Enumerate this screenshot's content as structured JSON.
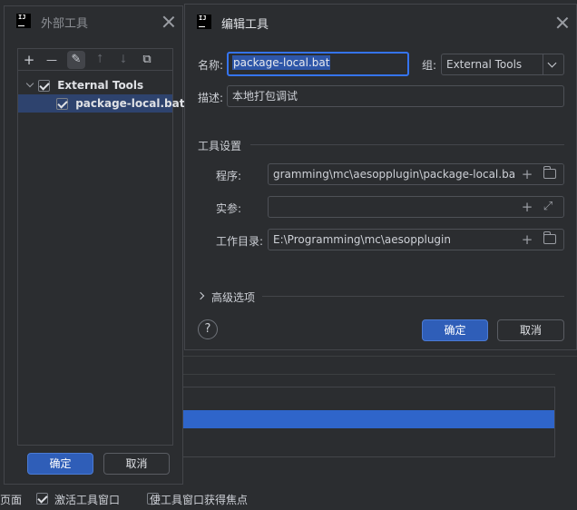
{
  "background": {
    "bottom_bar": {
      "partial_label": "页面",
      "activate_label": "激活工具窗口",
      "activate_checked": true,
      "focus_label": "使工具窗口获得焦点",
      "focus_checked": false
    }
  },
  "dialog_external_tools": {
    "title": "外部工具",
    "toolbar": {
      "add_icon": "+",
      "remove_icon": "—",
      "edit_icon": "✎",
      "up_icon": "⭡",
      "down_icon": "⭣",
      "copy_icon": "⧉"
    },
    "tree": {
      "group_label": "External Tools",
      "group_checked": true,
      "item_label": "package-local.bat",
      "item_checked": true
    },
    "ok_label": "确定",
    "cancel_label": "取消"
  },
  "dialog_edit_tool": {
    "title": "编辑工具",
    "name_label": "名称:",
    "name_value": "package-local.bat",
    "group_label": "组:",
    "group_value": "External Tools",
    "description_label": "描述:",
    "description_value": "本地打包调试",
    "tool_settings_label": "工具设置",
    "program_label": "程序:",
    "program_value": "gramming\\mc\\aesopplugin\\package-local.bat",
    "arguments_label": "实参:",
    "arguments_value": "",
    "workdir_label": "工作目录:",
    "workdir_value": "E:\\Programming\\mc\\aesopplugin",
    "advanced_label": "高级选项",
    "help_icon": "?",
    "ok_label": "确定",
    "cancel_label": "取消"
  }
}
